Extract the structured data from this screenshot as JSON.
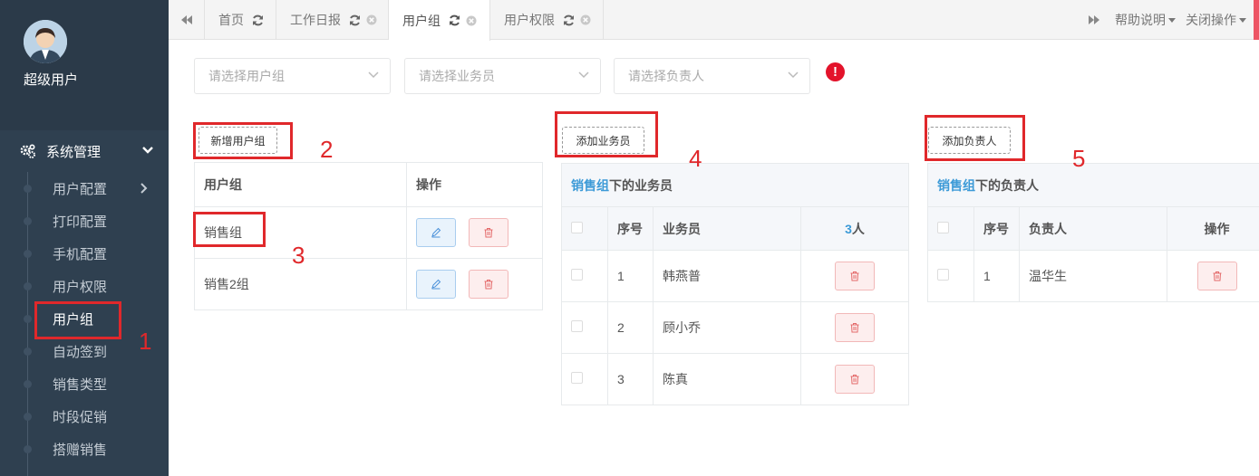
{
  "user": {
    "name": "超级用户"
  },
  "menu": {
    "section": "系统管理",
    "items": [
      {
        "label": "用户配置",
        "expandable": true
      },
      {
        "label": "打印配置"
      },
      {
        "label": "手机配置"
      },
      {
        "label": "用户权限"
      },
      {
        "label": "用户组",
        "active": true
      },
      {
        "label": "自动签到"
      },
      {
        "label": "销售类型"
      },
      {
        "label": "时段促销"
      },
      {
        "label": "搭赠销售"
      }
    ]
  },
  "tabs": [
    {
      "label": "首页"
    },
    {
      "label": "工作日报"
    },
    {
      "label": "用户组",
      "active": true
    },
    {
      "label": "用户权限"
    }
  ],
  "tabbar_right": {
    "help": "帮助说明",
    "close_ops": "关闭操作"
  },
  "filters": {
    "group_placeholder": "请选择用户组",
    "sales_placeholder": "请选择业务员",
    "manager_placeholder": "请选择负责人",
    "alert": "!"
  },
  "groups_panel": {
    "add_button": "新增用户组",
    "headers": {
      "group": "用户组",
      "ops": "操作"
    },
    "rows": [
      {
        "name": "销售组",
        "selected": true
      },
      {
        "name": "销售2组"
      }
    ]
  },
  "sales_panel": {
    "add_button": "添加业务员",
    "caption_group": "销售组",
    "caption_suffix": "下的业务员",
    "headers": {
      "index": "序号",
      "name": "业务员",
      "count_num": "3",
      "count_unit": "人"
    },
    "rows": [
      {
        "index": "1",
        "name": "韩燕普"
      },
      {
        "index": "2",
        "name": "顾小乔"
      },
      {
        "index": "3",
        "name": "陈真"
      }
    ]
  },
  "managers_panel": {
    "add_button": "添加负责人",
    "caption_group": "销售组",
    "caption_suffix": "下的负责人",
    "headers": {
      "index": "序号",
      "name": "负责人",
      "ops": "操作"
    },
    "rows": [
      {
        "index": "1",
        "name": "温华生"
      }
    ]
  },
  "annotations": [
    "1",
    "2",
    "3",
    "4",
    "5"
  ],
  "colors": {
    "sidebar": "#2f4050",
    "accent": "#3c9ad7",
    "annotation": "#e0282b"
  }
}
